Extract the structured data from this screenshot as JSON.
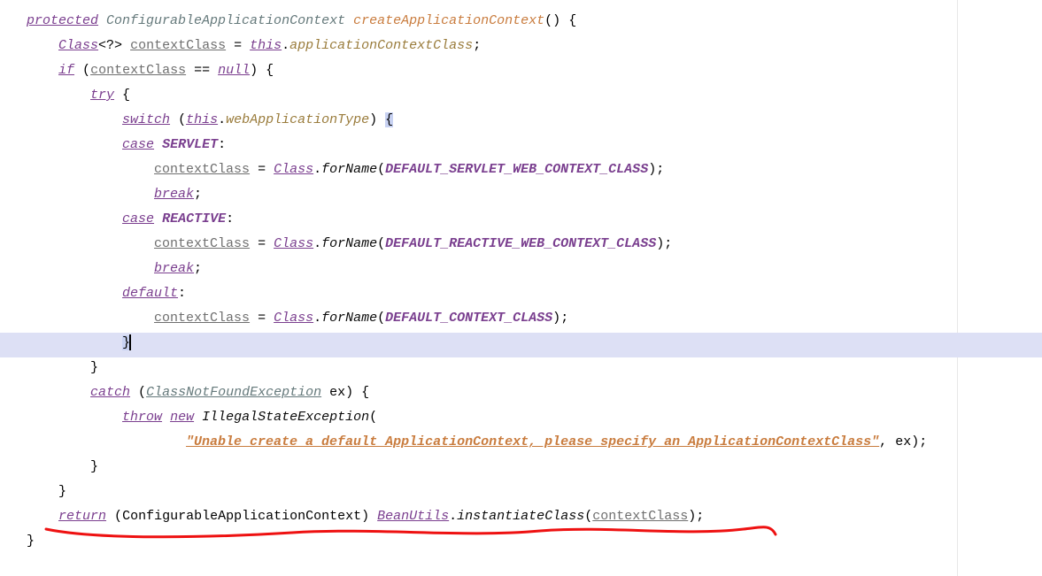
{
  "code": {
    "kw_protected": "protected",
    "ret_type": "ConfigurableApplicationContext",
    "method_name": "createApplicationContext",
    "paren_open": "(",
    "paren_close": ")",
    "brace_open": "{",
    "brace_close": "}",
    "class_ref": "Class",
    "generic": "<?>",
    "var_contextClass": "contextClass",
    "eq": " = ",
    "kw_this": "this",
    "dot": ".",
    "field_appCtxClass": "applicationContextClass",
    "semi": ";",
    "kw_if": "if",
    "dbl_eq": " == ",
    "kw_null": "null",
    "kw_try": "try",
    "kw_switch": "switch",
    "field_webAppType": "webApplicationType",
    "kw_case": "case",
    "enum_servlet": "SERVLET",
    "colon": ":",
    "call_forName": "forName",
    "const_servlet": "DEFAULT_SERVLET_WEB_CONTEXT_CLASS",
    "kw_break": "break",
    "enum_reactive": "REACTIVE",
    "const_reactive": "DEFAULT_REACTIVE_WEB_CONTEXT_CLASS",
    "kw_default": "default",
    "const_default": "DEFAULT_CONTEXT_CLASS",
    "kw_catch": "catch",
    "ex_cls": "ClassNotFoundException",
    "ex_var": "ex",
    "kw_throw": "throw",
    "kw_new": "new",
    "new_cls": "IllegalStateException",
    "str_msg": "\"Unable create a default ApplicationContext, please specify an ApplicationContextClass\"",
    "comma_sp": ", ",
    "kw_return": "return",
    "cast_type": "ConfigurableApplicationContext",
    "static_cls": "BeanUtils",
    "call_inst": "instantiateClass",
    "sp": " "
  }
}
